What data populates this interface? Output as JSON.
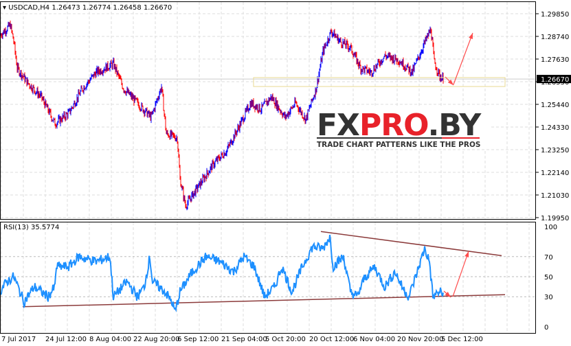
{
  "chart_data": [
    {
      "type": "bar",
      "title": "USDCAD,H4",
      "ohlc_label": "1.26473 1.26774 1.26458 1.26670",
      "current_price": "1.26670",
      "y_ticks": [
        "1.29850",
        "1.28740",
        "1.27630",
        "1.26530",
        "1.25440",
        "1.24330",
        "1.23250",
        "1.22140",
        "1.21030",
        "1.19950"
      ],
      "ylim": [
        1.1995,
        1.2985
      ],
      "price_path": [
        [
          0,
          1.288
        ],
        [
          15,
          1.293
        ],
        [
          20,
          1.285
        ],
        [
          25,
          1.272
        ],
        [
          40,
          1.265
        ],
        [
          60,
          1.258
        ],
        [
          80,
          1.245
        ],
        [
          100,
          1.25
        ],
        [
          120,
          1.262
        ],
        [
          140,
          1.27
        ],
        [
          165,
          1.274
        ],
        [
          180,
          1.262
        ],
        [
          200,
          1.255
        ],
        [
          220,
          1.248
        ],
        [
          235,
          1.263
        ],
        [
          242,
          1.24
        ],
        [
          258,
          1.238
        ],
        [
          262,
          1.218
        ],
        [
          270,
          1.205
        ],
        [
          290,
          1.215
        ],
        [
          310,
          1.225
        ],
        [
          330,
          1.232
        ],
        [
          350,
          1.245
        ],
        [
          365,
          1.255
        ],
        [
          380,
          1.252
        ],
        [
          395,
          1.258
        ],
        [
          415,
          1.248
        ],
        [
          430,
          1.255
        ],
        [
          445,
          1.247
        ],
        [
          460,
          1.262
        ],
        [
          470,
          1.28
        ],
        [
          482,
          1.29
        ],
        [
          495,
          1.285
        ],
        [
          510,
          1.282
        ],
        [
          525,
          1.272
        ],
        [
          540,
          1.27
        ],
        [
          560,
          1.278
        ],
        [
          580,
          1.276
        ],
        [
          600,
          1.27
        ],
        [
          615,
          1.282
        ],
        [
          627,
          1.291
        ],
        [
          632,
          1.275
        ],
        [
          640,
          1.268
        ],
        [
          645,
          1.2667
        ]
      ],
      "logo": {
        "brand": "FXPRO.BY",
        "tagline": "TRADE CHART PATTERNS LIKE THE PROS"
      }
    },
    {
      "type": "line",
      "title": "RSI(13) 35.5774",
      "y_ticks": [
        100,
        70,
        50,
        30,
        0
      ],
      "ylim": [
        0,
        100
      ],
      "rsi_path": [
        [
          0,
          35
        ],
        [
          10,
          45
        ],
        [
          20,
          50
        ],
        [
          35,
          25
        ],
        [
          50,
          40
        ],
        [
          70,
          30
        ],
        [
          80,
          40
        ],
        [
          82,
          60
        ],
        [
          100,
          60
        ],
        [
          115,
          70
        ],
        [
          140,
          65
        ],
        [
          160,
          70
        ],
        [
          165,
          30
        ],
        [
          185,
          45
        ],
        [
          200,
          30
        ],
        [
          210,
          40
        ],
        [
          218,
          70
        ],
        [
          222,
          45
        ],
        [
          240,
          35
        ],
        [
          250,
          25
        ],
        [
          255,
          15
        ],
        [
          262,
          35
        ],
        [
          280,
          55
        ],
        [
          300,
          70
        ],
        [
          320,
          65
        ],
        [
          340,
          55
        ],
        [
          355,
          70
        ],
        [
          370,
          60
        ],
        [
          385,
          30
        ],
        [
          400,
          40
        ],
        [
          410,
          60
        ],
        [
          425,
          35
        ],
        [
          440,
          60
        ],
        [
          455,
          80
        ],
        [
          470,
          78
        ],
        [
          480,
          90
        ],
        [
          485,
          60
        ],
        [
          500,
          70
        ],
        [
          510,
          35
        ],
        [
          520,
          30
        ],
        [
          530,
          48
        ],
        [
          545,
          60
        ],
        [
          560,
          40
        ],
        [
          575,
          55
        ],
        [
          585,
          40
        ],
        [
          595,
          30
        ],
        [
          605,
          50
        ],
        [
          618,
          78
        ],
        [
          625,
          65
        ],
        [
          630,
          30
        ],
        [
          640,
          35
        ],
        [
          645,
          32
        ]
      ],
      "trendlines": {
        "lower": [
          [
            33,
            20
          ],
          [
            735,
            32
          ]
        ],
        "upper": [
          [
            467,
            95
          ],
          [
            730,
            71
          ]
        ]
      }
    }
  ],
  "x_ticks": [
    "7 Jul 2017",
    "24 Jul 12:00",
    "8 Aug 04:00",
    "22 Aug 20:00",
    "6 Sep 12:00",
    "21 Sep 04:00",
    "5 Oct 20:00",
    "20 Oct 12:00",
    "6 Nov 04:00",
    "20 Nov 20:00",
    "5 Dec 12:00"
  ],
  "colors": {
    "up": "#0000ff",
    "down": "#ff0000",
    "rsi": "#1e90ff",
    "trend": "#8b3a3a",
    "arrow": "#ff4d4d"
  }
}
